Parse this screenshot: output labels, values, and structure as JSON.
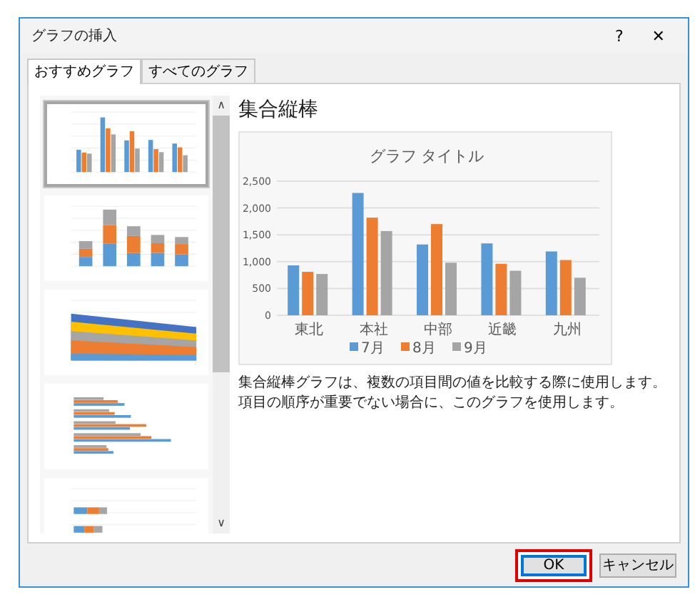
{
  "window": {
    "title": "グラフの挿入",
    "help": "?",
    "close": "✕"
  },
  "tabs": [
    {
      "label": "おすすめグラフ",
      "selected": true
    },
    {
      "label": "すべてのグラフ",
      "selected": false
    }
  ],
  "thumbnails": [
    {
      "kind": "clustered-column",
      "selected": true
    },
    {
      "kind": "stacked-column",
      "selected": false
    },
    {
      "kind": "area",
      "selected": false
    },
    {
      "kind": "bar",
      "selected": false
    },
    {
      "kind": "stacked-bar",
      "selected": false
    }
  ],
  "scroll": {
    "up": "∧",
    "down": "∨"
  },
  "preview": {
    "heading": "集合縦棒",
    "chart_data": {
      "type": "bar",
      "title": "グラフ タイトル",
      "categories": [
        "東北",
        "本社",
        "中部",
        "近畿",
        "九州"
      ],
      "series": [
        {
          "name": "7月",
          "color": "#5b9bd5",
          "values": [
            930,
            2280,
            1320,
            1340,
            1190
          ]
        },
        {
          "name": "8月",
          "color": "#ed7d31",
          "values": [
            810,
            1820,
            1700,
            960,
            1030
          ]
        },
        {
          "name": "9月",
          "color": "#a5a5a5",
          "values": [
            770,
            1570,
            980,
            830,
            700
          ]
        }
      ],
      "ylim": [
        0,
        2500
      ],
      "grid": true,
      "legend": true,
      "yticks": [
        {
          "value": 0,
          "label": "0"
        },
        {
          "value": 500,
          "label": "500"
        },
        {
          "value": 1000,
          "label": "1,000"
        },
        {
          "value": 1500,
          "label": "1,500"
        },
        {
          "value": 2000,
          "label": "2,000"
        },
        {
          "value": 2500,
          "label": "2,500"
        }
      ]
    },
    "description": "集合縦棒グラフは、複数の項目間の値を比較する際に使用します。項目の順序が重要でない場合に、このグラフを使用します。"
  },
  "buttons": [
    {
      "label": "OK",
      "kind": "primary",
      "highlighted": true
    },
    {
      "label": "キャンセル",
      "kind": "secondary",
      "highlighted": false
    }
  ]
}
